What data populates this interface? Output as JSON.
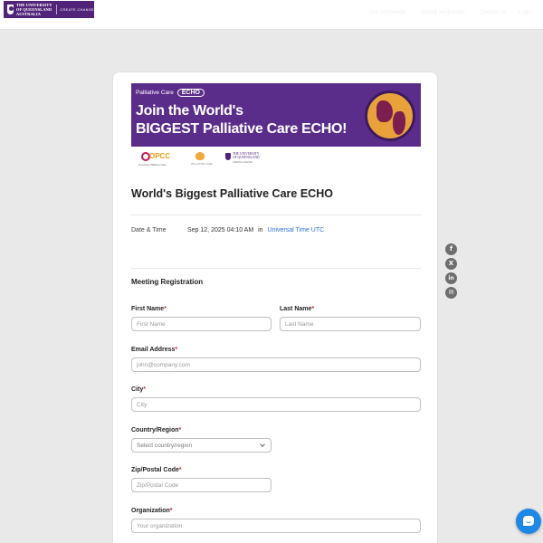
{
  "header": {
    "logo_line1": "THE UNIVERSITY",
    "logo_line2": "OF QUEENSLAND",
    "logo_line3": "AUSTRALIA",
    "logo_sub": "CREATE CHANGE",
    "nav": [
      "Our community",
      "Global workshops",
      "Contact us",
      "Login"
    ]
  },
  "banner": {
    "echo_prefix": "Palliative Care",
    "echo_badge": "ECHO",
    "line1": "Join the World's",
    "line2": "BIGGEST Palliative Care ECHO!"
  },
  "partners": {
    "opcc": "OPCC",
    "opcc_sub": "Oncology Palliative Care",
    "heart_sub": "PALLIATIVE CARE",
    "uq_line1": "THE UNIVERSITY",
    "uq_line2": "OF QUEENSLAND",
    "uq_sub": "CREATE CHANGE"
  },
  "event": {
    "title": "World's Biggest Palliative Care ECHO",
    "date_label": "Date & Time",
    "date_value": "Sep 12, 2025 04:10 AM",
    "date_in": "in",
    "timezone": "Universal Time UTC"
  },
  "form": {
    "section_title": "Meeting Registration",
    "required_mark": "*",
    "first_name": {
      "label": "First Name",
      "placeholder": "First Name"
    },
    "last_name": {
      "label": "Last Name",
      "placeholder": "Last Name"
    },
    "email": {
      "label": "Email Address",
      "placeholder": "john@company.com"
    },
    "city": {
      "label": "City",
      "placeholder": "City"
    },
    "country": {
      "label": "Country/Region",
      "placeholder": "Select country/region"
    },
    "zip": {
      "label": "Zip/Postal Code",
      "placeholder": "Zip/Postal Code"
    },
    "organization": {
      "label": "Organization",
      "placeholder": "Your organization"
    }
  },
  "share": {
    "facebook_glyph": "f",
    "x_glyph": "X",
    "linkedin_glyph": "in",
    "email_glyph": "✉"
  },
  "colors": {
    "brand_purple": "#51247a",
    "banner_purple": "#5b2d8a",
    "link_blue": "#2e6fd6",
    "required_red": "#d9262c",
    "chat_blue": "#1e88e5"
  }
}
